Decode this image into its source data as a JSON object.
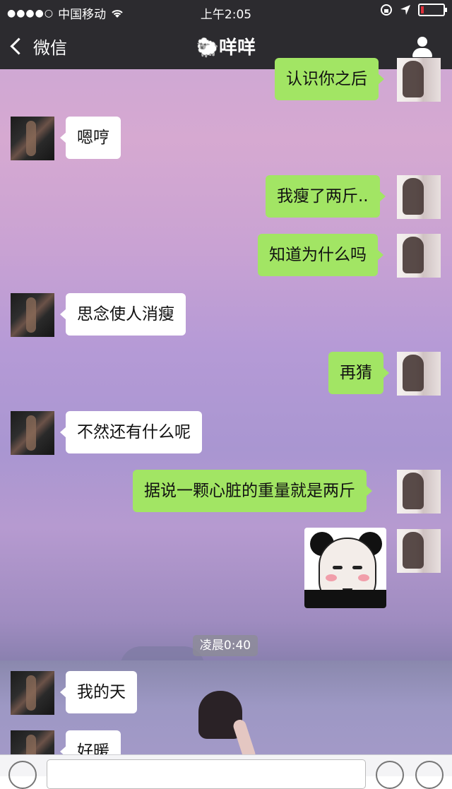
{
  "status_bar": {
    "signal": "●●●●○",
    "carrier": "中国移动",
    "wifi": "wifi-icon",
    "time": "上午2:05",
    "lock": "rotation-lock-icon",
    "location": "location-arrow-icon",
    "battery_color": "#e0303a"
  },
  "nav": {
    "back_label": "微信",
    "title_emoji": "🐑",
    "title": "咩咩",
    "profile_icon": "person-icon"
  },
  "messages": [
    {
      "from": "me",
      "text": "认识你之后"
    },
    {
      "from": "them",
      "text": "嗯哼"
    },
    {
      "from": "me",
      "text": "我瘦了两斤.."
    },
    {
      "from": "me",
      "text": "知道为什么吗"
    },
    {
      "from": "them",
      "text": "思念使人消瘦"
    },
    {
      "from": "me",
      "text": "再猜"
    },
    {
      "from": "them",
      "text": "不然还有什么呢"
    },
    {
      "from": "me",
      "text": "据说一颗心脏的重量就是两斤"
    },
    {
      "from": "me",
      "sticker": "blushing-panda-sticker"
    },
    {
      "from": "them",
      "text": "我的天"
    },
    {
      "from": "them",
      "text": "好暖"
    }
  ],
  "timestamp": "凌晨0:40",
  "colors": {
    "my_bubble": "#a2e564",
    "their_bubble": "#ffffff",
    "topbar": "#2c2b2f"
  }
}
